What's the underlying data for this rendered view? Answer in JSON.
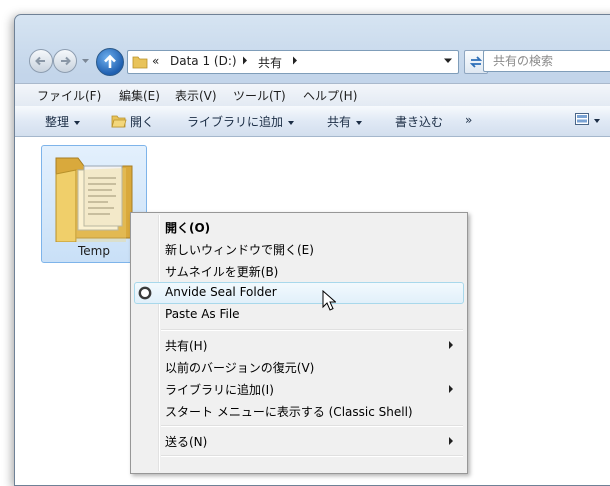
{
  "window": {
    "address": {
      "prefix": "«",
      "segments": [
        "Data 1 (D:)",
        "共有"
      ]
    },
    "search": {
      "placeholder": "共有の検索"
    }
  },
  "menubar": [
    "ファイル(F)",
    "編集(E)",
    "表示(V)",
    "ツール(T)",
    "ヘルプ(H)"
  ],
  "toolbar": {
    "organize": "整理",
    "open": "開く",
    "add_library": "ライブラリに追加",
    "share": "共有",
    "burn": "書き込む",
    "more": "»"
  },
  "folder": {
    "name": "Temp"
  },
  "context_menu": {
    "items": [
      "開く(O)",
      "新しいウィンドウで開く(E)",
      "サムネイルを更新(B)",
      "Anvide Seal Folder",
      "Paste As File",
      "共有(H)",
      "以前のバージョンの復元(V)",
      "ライブラリに追加(I)",
      "スタート メニューに表示する (Classic Shell)",
      "送る(N)"
    ]
  }
}
